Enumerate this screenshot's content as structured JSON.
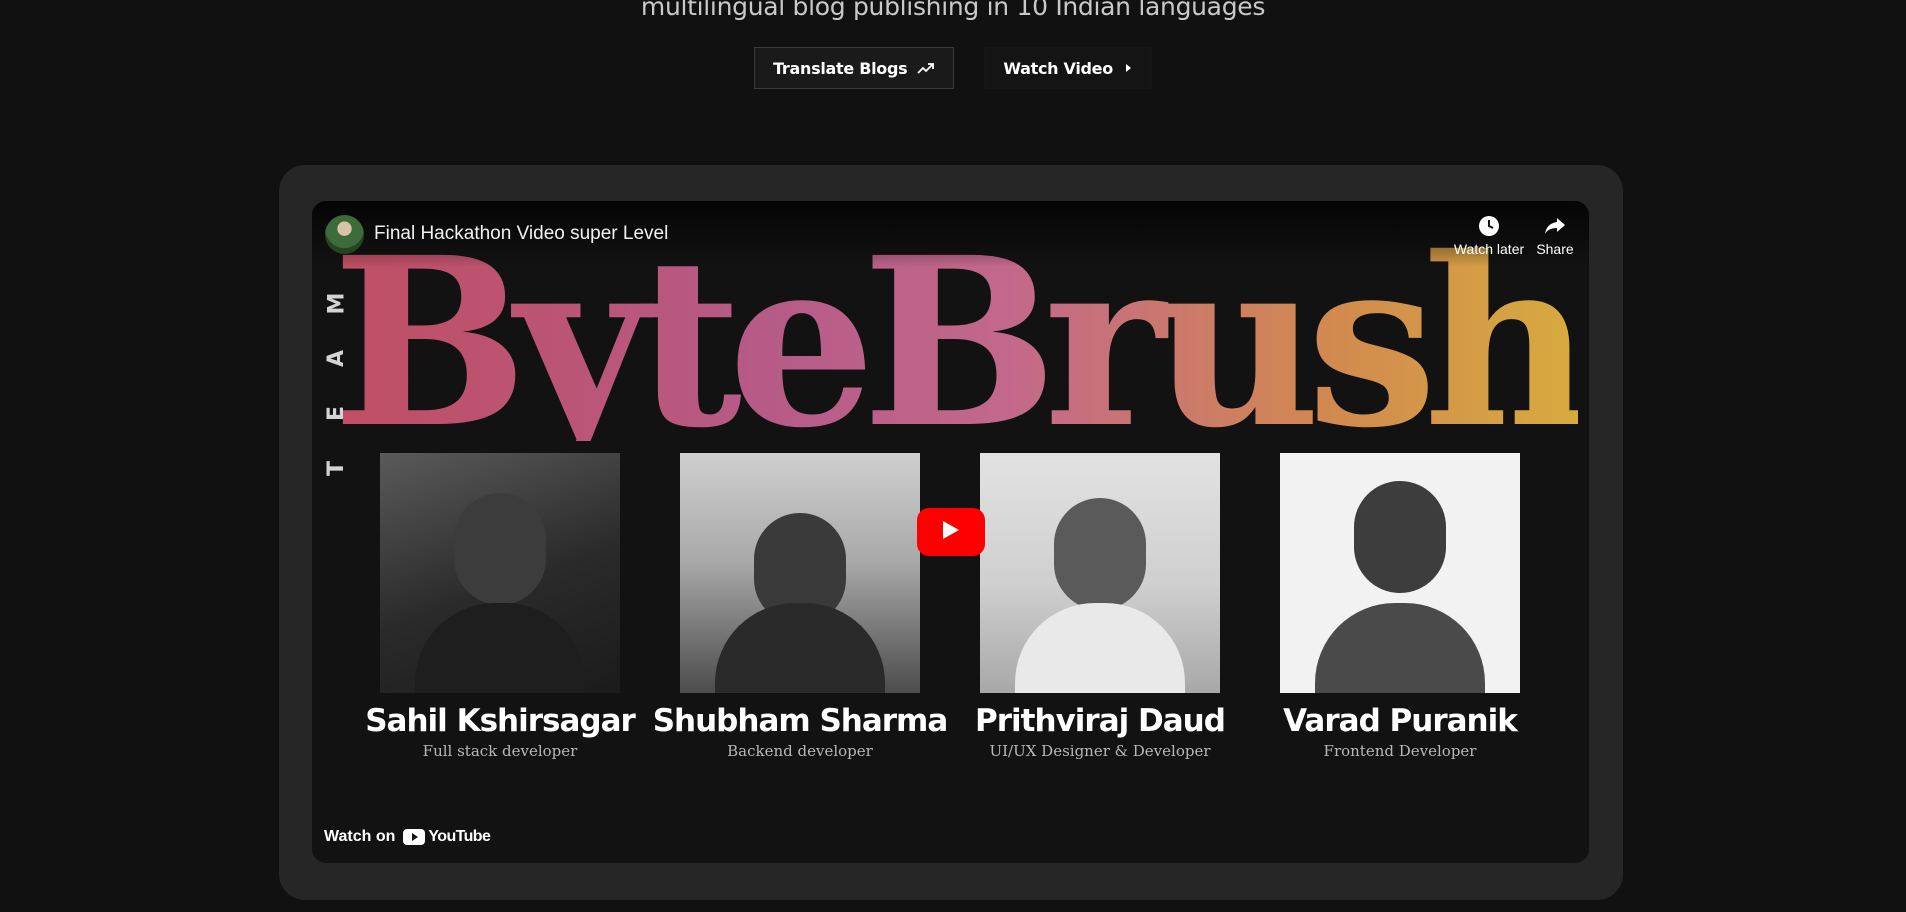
{
  "hero": {
    "subtitle": "multilingual blog publishing in 10 Indian languages",
    "buttons": [
      {
        "label": "Translate Blogs",
        "icon": "trending-up-icon"
      },
      {
        "label": "Watch Video",
        "icon": "caret-right-icon"
      }
    ]
  },
  "video": {
    "title": "Final Hackathon Video super Level",
    "actions": [
      {
        "label": "Watch later",
        "icon": "clock-icon"
      },
      {
        "label": "Share",
        "icon": "share-icon"
      }
    ],
    "team_letters": [
      "T",
      "E",
      "A",
      "M"
    ],
    "brand": "ByteBrush",
    "members": [
      {
        "name": "Sahil Kshirsagar",
        "role": "Full stack developer"
      },
      {
        "name": "Shubham Sharma",
        "role": "Backend developer"
      },
      {
        "name": "Prithviraj Daud",
        "role": "UI/UX Designer & Developer"
      },
      {
        "name": "Varad Puranik",
        "role": "Frontend Developer"
      }
    ],
    "watch_on": "Watch on",
    "youtube_logo": "YouTube",
    "colors": {
      "play_button": "#ff0000",
      "frame": "#262626",
      "background": "#111111"
    }
  }
}
